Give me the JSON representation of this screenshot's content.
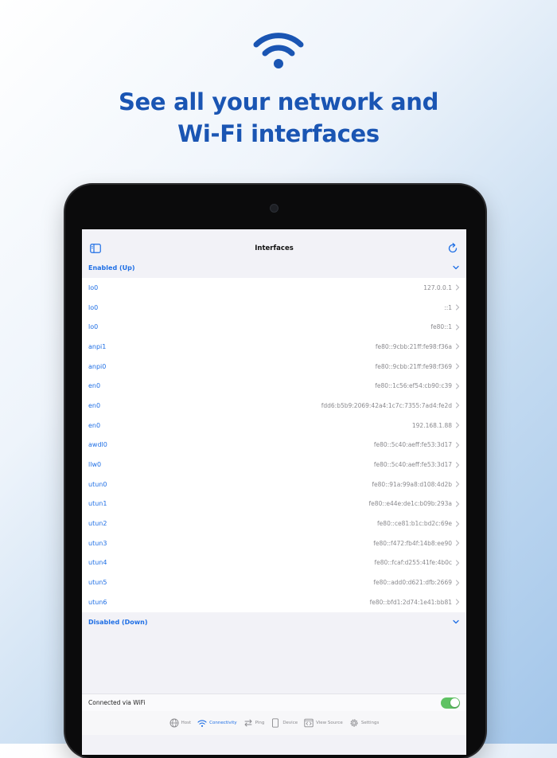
{
  "promo": {
    "headline_line1": "See all your network and",
    "headline_line2": "Wi-Fi interfaces"
  },
  "nav": {
    "title": "Interfaces"
  },
  "sections": {
    "enabled_title": "Enabled (Up)",
    "disabled_title": "Disabled (Down)"
  },
  "interfaces": [
    {
      "name": "lo0",
      "address": "127.0.0.1"
    },
    {
      "name": "lo0",
      "address": "::1"
    },
    {
      "name": "lo0",
      "address": "fe80::1"
    },
    {
      "name": "anpi1",
      "address": "fe80::9cbb:21ff:fe98:f36a"
    },
    {
      "name": "anpi0",
      "address": "fe80::9cbb:21ff:fe98:f369"
    },
    {
      "name": "en0",
      "address": "fe80::1c56:ef54:cb90:c39"
    },
    {
      "name": "en0",
      "address": "fdd6:b5b9:2069:42a4:1c7c:7355:7ad4:fe2d"
    },
    {
      "name": "en0",
      "address": "192.168.1.88"
    },
    {
      "name": "awdl0",
      "address": "fe80::5c40:aeff:fe53:3d17"
    },
    {
      "name": "llw0",
      "address": "fe80::5c40:aeff:fe53:3d17"
    },
    {
      "name": "utun0",
      "address": "fe80::91a:99a8:d108:4d2b"
    },
    {
      "name": "utun1",
      "address": "fe80::e44e:de1c:b09b:293a"
    },
    {
      "name": "utun2",
      "address": "fe80::ce81:b1c:bd2c:69e"
    },
    {
      "name": "utun3",
      "address": "fe80::f472:fb4f:14b8:ee90"
    },
    {
      "name": "utun4",
      "address": "fe80::fcaf:d255:41fe:4b0c"
    },
    {
      "name": "utun5",
      "address": "fe80::add0:d621:dfb:2669"
    },
    {
      "name": "utun6",
      "address": "fe80::bfd1:2d74:1e41:bb81"
    }
  ],
  "footer": {
    "wifi_label": "Connected via WiFi",
    "wifi_enabled": true
  },
  "tabs": [
    {
      "label": "Host",
      "icon": "globe-icon",
      "active": false
    },
    {
      "label": "Connectivity",
      "icon": "wifi-icon",
      "active": true
    },
    {
      "label": "Ping",
      "icon": "arrows-icon",
      "active": false
    },
    {
      "label": "Device",
      "icon": "device-icon",
      "active": false
    },
    {
      "label": "View Source",
      "icon": "code-icon",
      "active": false
    },
    {
      "label": "Settings",
      "icon": "gear-icon",
      "active": false
    }
  ],
  "colors": {
    "accent": "#1f6fe5",
    "headline": "#1a55b3",
    "toggle_on": "#5fc263"
  }
}
